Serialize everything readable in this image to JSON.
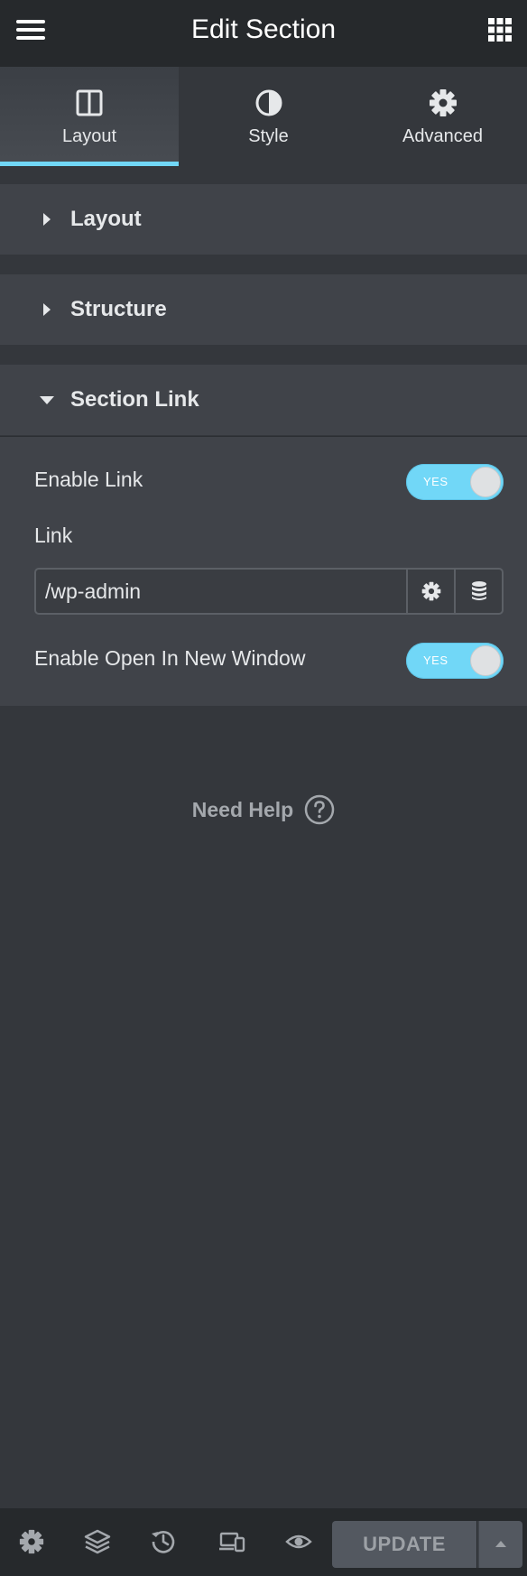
{
  "header": {
    "title": "Edit Section",
    "menu_icon": "hamburger-icon",
    "apps_icon": "grid-icon"
  },
  "tabs": [
    {
      "label": "Layout",
      "icon": "columns-icon",
      "active": true
    },
    {
      "label": "Style",
      "icon": "half-circle-icon",
      "active": false
    },
    {
      "label": "Advanced",
      "icon": "gear-icon",
      "active": false
    }
  ],
  "sections": {
    "layout": {
      "title": "Layout",
      "expanded": false
    },
    "structure": {
      "title": "Structure",
      "expanded": false
    },
    "section_link": {
      "title": "Section Link",
      "expanded": true
    }
  },
  "section_link": {
    "enable_link_label": "Enable Link",
    "enable_link_toggle": "YES",
    "link_label": "Link",
    "link_value": "/wp-admin",
    "enable_new_window_label": "Enable Open In New Window",
    "enable_new_window_toggle": "YES"
  },
  "help": {
    "label": "Need Help",
    "icon": "question-circle-icon"
  },
  "footer": {
    "icons": [
      "settings-icon",
      "layers-icon",
      "history-icon",
      "responsive-icon",
      "preview-eye-icon"
    ],
    "update_label": "UPDATE"
  },
  "colors": {
    "accent": "#71d7f7",
    "panel_bg": "#34373c",
    "header_bg": "#26292c",
    "section_bg": "#404349"
  }
}
